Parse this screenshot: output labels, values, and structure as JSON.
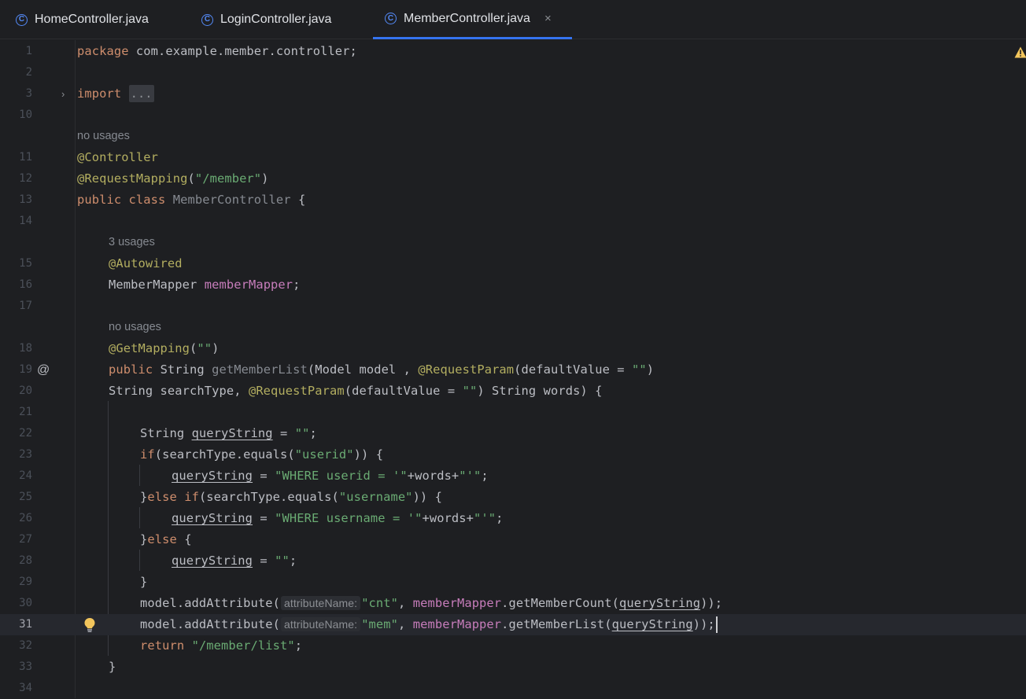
{
  "tabs": [
    {
      "icon": "class-icon",
      "icon_glyph": "C",
      "label": "HomeController.java"
    },
    {
      "icon": "class-icon",
      "icon_glyph": "C",
      "label": "LoginController.java"
    },
    {
      "icon": "class-icon",
      "icon_glyph": "C",
      "label": "MemberController.java",
      "active": true,
      "close": "×"
    }
  ],
  "editor": {
    "line_numbers": [
      "1",
      "2",
      "3",
      "10",
      "11",
      "12",
      "13",
      "14",
      "15",
      "16",
      "17",
      "18",
      "19",
      "20",
      "21",
      "22",
      "23",
      "24",
      "25",
      "26",
      "27",
      "28",
      "29",
      "30",
      "31",
      "32",
      "33",
      "34"
    ],
    "current_line": "31",
    "hints": {
      "no_usages_1": "no usages",
      "three_usages": "3 usages",
      "no_usages_2": "no usages"
    },
    "code": {
      "l1_kw": "package",
      "l1_rest": " com.example.member.controller;",
      "l3_kw": "import",
      "l3_fold": "...",
      "l11": "@Controller",
      "l12_ann": "@RequestMapping",
      "l12_p1": "(",
      "l12_str": "\"/member\"",
      "l12_p2": ")",
      "l13_kw": "public class",
      "l13_name": " MemberController",
      "l13_rest": " {",
      "l15": "@Autowired",
      "l16_type": "MemberMapper ",
      "l16_field": "memberMapper",
      "l16_rest": ";",
      "l18_ann": "@GetMapping",
      "l18_p1": "(",
      "l18_str": "\"\"",
      "l18_p2": ")",
      "l19_kw": "public",
      "l19_t": " String ",
      "l19_m": "getMemberList",
      "l19_a": "(Model model , ",
      "l19_ann": "@RequestParam",
      "l19_b": "(defaultValue = ",
      "l19_str": "\"\"",
      "l19_c": ")",
      "l20_a": "String searchType, ",
      "l20_ann": "@RequestParam",
      "l20_b": "(defaultValue = ",
      "l20_str": "\"\"",
      "l20_c": ") String words) {",
      "l22_a": "String ",
      "l22_v": "queryString",
      "l22_b": " = ",
      "l22_str": "\"\"",
      "l22_c": ";",
      "l23_kw": "if",
      "l23_a": "(searchType.equals(",
      "l23_str": "\"userid\"",
      "l23_b": ")) {",
      "l24_v": "queryString",
      "l24_a": " = ",
      "l24_str1": "\"WHERE userid = '\"",
      "l24_b": "+words+",
      "l24_str2": "\"'\"",
      "l24_c": ";",
      "l25_a": "}",
      "l25_kw": "else if",
      "l25_b": "(searchType.equals(",
      "l25_str": "\"username\"",
      "l25_c": ")) {",
      "l26_v": "queryString",
      "l26_a": " = ",
      "l26_str1": "\"WHERE username = '\"",
      "l26_b": "+words+",
      "l26_str2": "\"'\"",
      "l26_c": ";",
      "l27_a": "}",
      "l27_kw": "else",
      "l27_b": " {",
      "l28_v": "queryString",
      "l28_a": " = ",
      "l28_str": "\"\"",
      "l28_c": ";",
      "l29": "}",
      "l30_a": "model.addAttribute(",
      "l30_hint": "attributeName:",
      "l30_str": "\"cnt\"",
      "l30_b": ", ",
      "l30_f": "memberMapper",
      "l30_c": ".getMemberCount(",
      "l30_v": "queryString",
      "l30_d": "));",
      "l31_a": "model.addAttribute(",
      "l31_hint": "attributeName:",
      "l31_str": "\"mem\"",
      "l31_b": ", ",
      "l31_f": "memberMapper",
      "l31_c": ".getMemberList(",
      "l31_v": "queryString",
      "l31_d": "));",
      "l32_kw": "return",
      "l32_a": " ",
      "l32_str": "\"/member/list\"",
      "l32_b": ";",
      "l33": "}"
    },
    "gutter_icons": {
      "line19": "@",
      "line3_fold": "›"
    },
    "colors": {
      "background": "#1e1f22",
      "keyword": "#cf8e6d",
      "annotation": "#b3ae60",
      "string": "#6aab73",
      "field": "#c77dbb",
      "accent": "#3574f0",
      "warning": "#f2c55c"
    }
  }
}
